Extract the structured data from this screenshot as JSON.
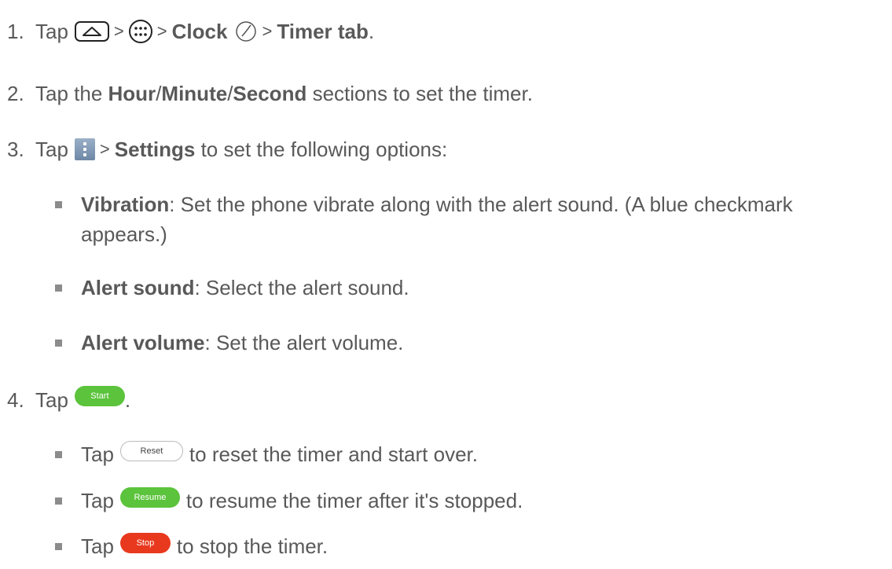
{
  "steps": {
    "s1": {
      "num": "1.",
      "tap": "Tap",
      "gt1": ">",
      "gt2": ">",
      "clock": "Clock",
      "gt3": ">",
      "timer_tab": "Timer tab",
      "end": "."
    },
    "s2": {
      "num": "2.",
      "pre": "Tap the ",
      "hour": "Hour",
      "slash1": "/",
      "minute": "Minute",
      "slash2": "/",
      "second": "Second",
      "post": " sections to set the timer."
    },
    "s3": {
      "num": "3.",
      "tap": "Tap",
      "gt": ">",
      "settings": "Settings",
      "post": " to set the following options:"
    },
    "s4": {
      "num": "4.",
      "tap": "Tap",
      "end": "."
    }
  },
  "options": {
    "vibration": {
      "label": "Vibration",
      "text": ": Set the phone vibrate along with the alert sound. (A blue checkmark",
      "text2": "appears.)"
    },
    "alert_sound": {
      "label": "Alert sound",
      "text": ": Select the alert sound."
    },
    "alert_volume": {
      "label": "Alert volume",
      "text": ": Set the alert volume."
    }
  },
  "substeps": {
    "reset": {
      "tap": "Tap",
      "post": "to reset the timer and start over."
    },
    "resume": {
      "tap": "Tap",
      "post": "to resume the timer after it's stopped."
    },
    "stop": {
      "tap": "Tap",
      "post": "to stop the timer."
    }
  },
  "buttons": {
    "start": "Start",
    "reset": "Reset",
    "resume": "Resume",
    "stop": "Stop"
  },
  "icons": {
    "home": "home-key-icon",
    "apps": "apps-icon",
    "clock": "clock-icon",
    "menu": "menu-icon"
  }
}
